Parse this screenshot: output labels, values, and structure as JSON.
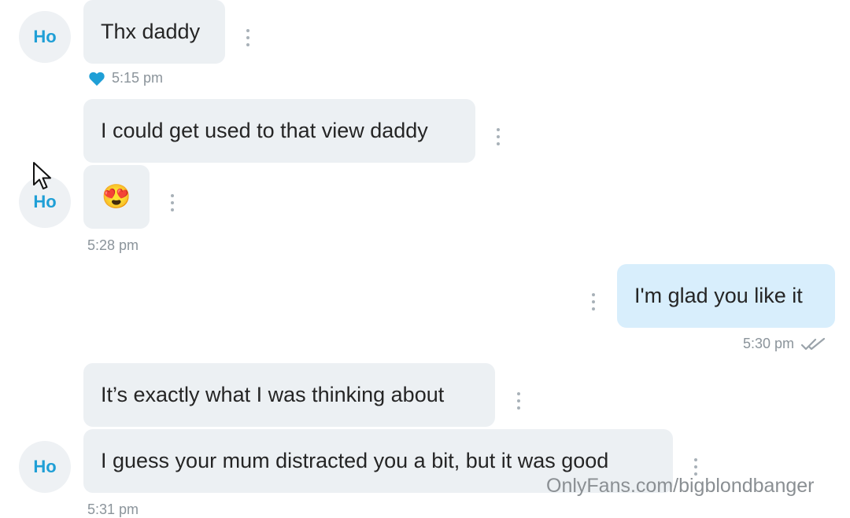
{
  "contact": {
    "avatar_initials": "Ho"
  },
  "messages": [
    {
      "text": "Thx daddy",
      "direction": "incoming"
    },
    {
      "text": "I could get used to that view daddy",
      "direction": "incoming"
    },
    {
      "text": "😍",
      "direction": "incoming"
    },
    {
      "text": "I'm glad you like it",
      "direction": "outgoing"
    },
    {
      "text": "It’s exactly what I was thinking about",
      "direction": "incoming"
    },
    {
      "text": "I guess your mum distracted you a bit, but it was good",
      "direction": "incoming"
    }
  ],
  "timestamps": {
    "t1": "5:15 pm",
    "t2": "5:28 pm",
    "t3": "5:30 pm",
    "t4": "5:31 pm"
  },
  "icons": {
    "liked": "heart-icon",
    "menu": "more-vertical-icon",
    "read": "double-check-icon",
    "pointer": "mouse-cursor-icon"
  },
  "colors": {
    "accent": "#1f9fd6",
    "incoming_bubble": "#ecf0f3",
    "outgoing_bubble": "#d8eefc",
    "timestamp": "#8b949b"
  },
  "watermark": "OnlyFans.com/bigblondbanger"
}
